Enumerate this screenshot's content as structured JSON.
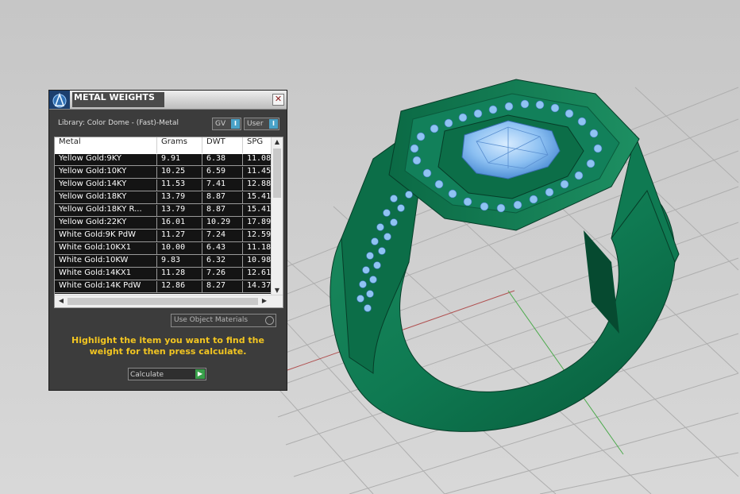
{
  "panel": {
    "title": "METAL WEIGHTS",
    "close_glyph": "✕",
    "library_label": "Library: Color Dome - (Fast)-Metal",
    "toggle_gv": {
      "label": "GV",
      "state": "I"
    },
    "toggle_user": {
      "label": "User",
      "state": "I"
    },
    "columns": [
      "Metal",
      "Grams",
      "DWT",
      "SPG"
    ],
    "rows": [
      [
        "Yellow Gold:9KY",
        "9.91",
        "6.38",
        "11.08"
      ],
      [
        "Yellow Gold:10KY",
        "10.25",
        "6.59",
        "11.45"
      ],
      [
        "Yellow Gold:14KY",
        "11.53",
        "7.41",
        "12.88"
      ],
      [
        "Yellow Gold:18KY",
        "13.79",
        "8.87",
        "15.41"
      ],
      [
        "Yellow Gold:18KY R...",
        "13.79",
        "8.87",
        "15.41"
      ],
      [
        "Yellow Gold:22KY",
        "16.01",
        "10.29",
        "17.89"
      ],
      [
        "White Gold:9K PdW",
        "11.27",
        "7.24",
        "12.59"
      ],
      [
        "White Gold:10KX1",
        "10.00",
        "6.43",
        "11.18"
      ],
      [
        "White Gold:10KW",
        "9.83",
        "6.32",
        "10.98"
      ],
      [
        "White Gold:14KX1",
        "11.28",
        "7.26",
        "12.61"
      ],
      [
        "White Gold:14K PdW",
        "12.86",
        "8.27",
        "14.37"
      ]
    ],
    "use_object_materials_label": "Use Object Materials",
    "hint": "Highlight the item you want to find the weight for then press calculate.",
    "calculate_label": "Calculate",
    "calculate_glyph": "▶"
  },
  "colors": {
    "panel_bg": "#3c3c3c",
    "hint_text": "#f2c521",
    "ring_green": "#0f7a52",
    "gem_blue": "#7ab6ee",
    "toggle_accent": "#49a2c8",
    "calc_go": "#39a04a"
  },
  "icons": {
    "logo": "app-logo-icon",
    "close": "close-icon",
    "calculate": "play-arrow-icon"
  }
}
